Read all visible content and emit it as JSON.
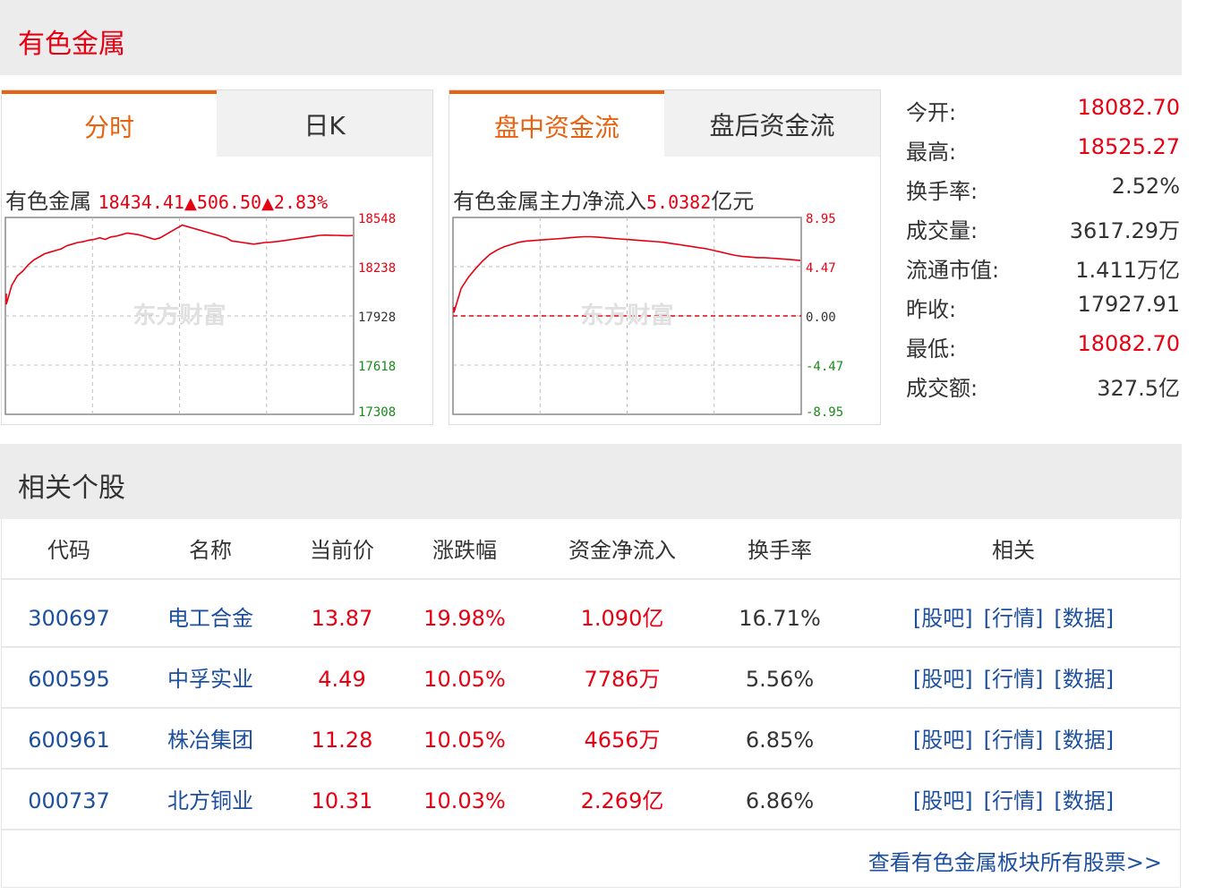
{
  "board": {
    "title": "有色金属"
  },
  "kline_panel": {
    "tabs": [
      "分时",
      "日K"
    ],
    "title_name": "有色金属",
    "price": "18434.41",
    "up_arrow": "▲",
    "change": "506.50",
    "pct": "2.83%",
    "y_labels": [
      "18548",
      "18238",
      "17928",
      "17618",
      "17308"
    ],
    "watermark": "东方财富"
  },
  "flow_panel": {
    "tabs": [
      "盘中资金流",
      "盘后资金流"
    ],
    "title_prefix": "有色金属主力净流入",
    "value": "5.0382",
    "unit": "亿元",
    "y_labels": [
      "8.95",
      "4.47",
      "0.00",
      "-4.47",
      "-8.95"
    ],
    "watermark": "东方财富"
  },
  "chart_data": [
    {
      "type": "line",
      "title": "",
      "ylim": [
        17308,
        18548
      ],
      "y_ticks": [
        18548,
        18238,
        17928,
        17618,
        17308
      ],
      "series": [
        {
          "values": [
            18000,
            18120,
            18180,
            18210,
            18250,
            18280,
            18300,
            18320,
            18330,
            18340,
            18350,
            18370,
            18380,
            18390,
            18395,
            18405,
            18410,
            18420,
            18410,
            18425,
            18430,
            18440,
            18450,
            18445,
            18440,
            18430,
            18420,
            18410,
            18420,
            18440,
            18460,
            18480,
            18500,
            18490,
            18480,
            18470,
            18460,
            18450,
            18440,
            18430,
            18420,
            18400,
            18395,
            18390,
            18385,
            18380,
            18385,
            18390,
            18392,
            18395,
            18400,
            18405,
            18410,
            18415,
            18420,
            18425,
            18430,
            18435,
            18437,
            18436,
            18435,
            18434,
            18433,
            18434
          ]
        }
      ],
      "grid": true
    },
    {
      "type": "line",
      "title": "",
      "ylim": [
        -8.95,
        8.95
      ],
      "y_ticks": [
        8.95,
        4.47,
        0.0,
        -4.47,
        -8.95
      ],
      "series": [
        {
          "values": [
            0.3,
            2.5,
            3.5,
            4.3,
            5.0,
            5.6,
            6.0,
            6.3,
            6.5,
            6.7,
            6.8,
            6.85,
            6.9,
            6.95,
            7.0,
            7.05,
            7.1,
            7.15,
            7.2,
            7.2,
            7.15,
            7.1,
            7.05,
            7.0,
            6.95,
            6.9,
            6.85,
            6.8,
            6.75,
            6.7,
            6.6,
            6.5,
            6.4,
            6.3,
            6.2,
            6.1,
            5.95,
            5.8,
            5.65,
            5.5,
            5.4,
            5.35,
            5.3,
            5.3,
            5.25,
            5.2,
            5.15,
            5.1,
            5.04
          ]
        }
      ],
      "grid": true
    }
  ],
  "stats": [
    {
      "label": "今开:",
      "value": "18082.70",
      "color": "red"
    },
    {
      "label": "最高:",
      "value": "18525.27",
      "color": "red"
    },
    {
      "label": "换手率:",
      "value": "2.52%",
      "color": "normal"
    },
    {
      "label": "成交量:",
      "value": "3617.29万",
      "color": "normal"
    },
    {
      "label": "流通市值:",
      "value": "1.411万亿",
      "color": "normal"
    },
    {
      "label": "昨收:",
      "value": "17927.91",
      "color": "normal"
    },
    {
      "label": "最低:",
      "value": "18082.70",
      "color": "red"
    },
    {
      "label": "成交额:",
      "value": "327.5亿",
      "color": "normal"
    }
  ],
  "related": {
    "title": "相关个股",
    "headers": [
      "代码",
      "名称",
      "当前价",
      "涨跌幅",
      "资金净流入",
      "换手率",
      "相关"
    ],
    "rows": [
      {
        "code": "300697",
        "name": "电工合金",
        "price": "13.87",
        "pct": "19.98%",
        "flow": "1.090亿",
        "turnover": "16.71%"
      },
      {
        "code": "600595",
        "name": "中孚实业",
        "price": "4.49",
        "pct": "10.05%",
        "flow": "7786万",
        "turnover": "5.56%"
      },
      {
        "code": "600961",
        "name": "株冶集团",
        "price": "11.28",
        "pct": "10.05%",
        "flow": "4656万",
        "turnover": "6.85%"
      },
      {
        "code": "000737",
        "name": "北方铜业",
        "price": "10.31",
        "pct": "10.03%",
        "flow": "2.269亿",
        "turnover": "6.86%"
      }
    ],
    "links": [
      "[股吧]",
      "[行情]",
      "[数据]"
    ],
    "more": "查看有色金属板块所有股票>>"
  }
}
